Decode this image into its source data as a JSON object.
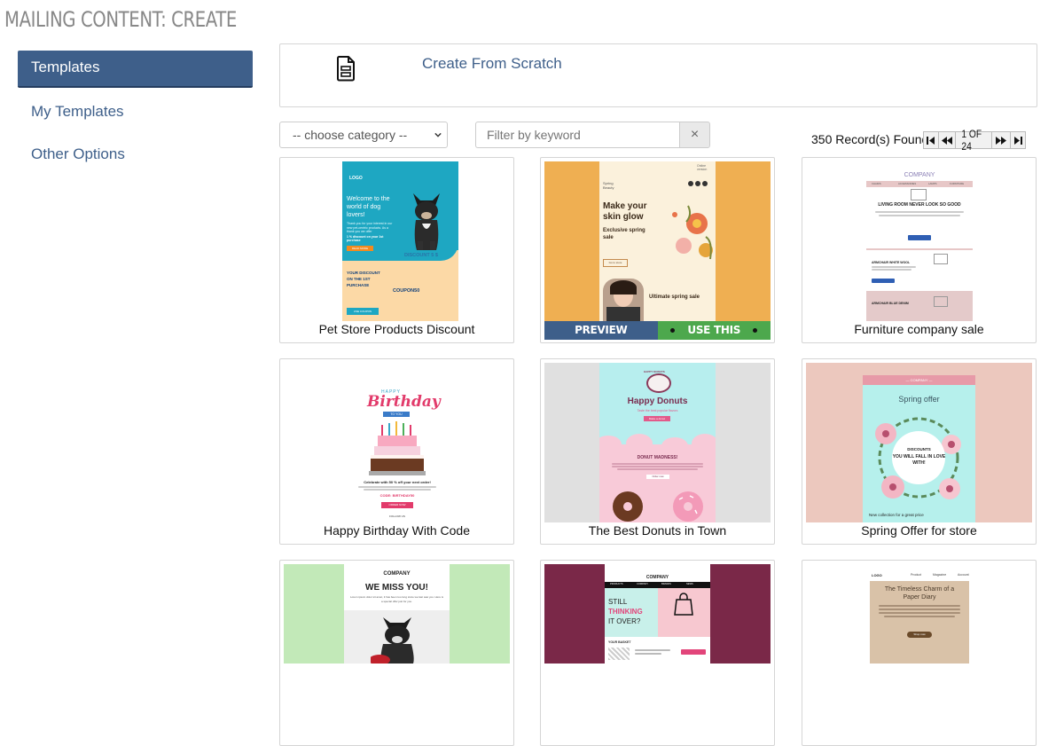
{
  "page": {
    "title": "MAILING CONTENT: CREATE"
  },
  "sidebar": {
    "items": [
      {
        "label": "Templates"
      },
      {
        "label": "My Templates"
      },
      {
        "label": "Other Options"
      }
    ]
  },
  "scratch": {
    "label": "Create From Scratch",
    "icon": "document-icon"
  },
  "filters": {
    "category_value": "-- choose category --",
    "keyword_placeholder": "Filter by keyword",
    "clear_glyph": "×"
  },
  "records": {
    "text": "350 Record(s) Found",
    "page_text": "1 OF 24"
  },
  "actions": {
    "preview": "PREVIEW",
    "use_this": "USE THIS"
  },
  "colors": {
    "accent": "#3e5f8a",
    "use_green": "#4da84d"
  },
  "templates": [
    {
      "name": "Pet Store Products Discount",
      "thumb": {
        "logo": "LOGO",
        "h1": "Welcome to the world of dog lovers!",
        "body": "Thank you for your interest in our new pet-centric products. As a thank you we offer",
        "offer": "1 % discount on your 1st purchase",
        "btn": "READ MORE",
        "discount": "DISCOUNT 5 $",
        "your": "YOUR DISCOUNT ON THE 1ST PURCHASE",
        "code": "COUPON50",
        "btn2": "USE COUPON"
      }
    },
    {
      "name": "Make your skin glow",
      "thumb": {
        "brand": "Spring Beauty",
        "h1": "Make your skin glow",
        "h2": "Exclusive spring sale",
        "btn": "Go to store",
        "h3": "Ultimate spring sale",
        "view": "Online version"
      }
    },
    {
      "name": "Furniture company sale",
      "thumb": {
        "logo": "COMPANY",
        "nav": [
          "CHAIRS",
          "ACCESSORIES",
          "LAMPS",
          "FURNITURE"
        ],
        "h1": "LIVING ROOM NEVER LOOK SO GOOD",
        "h2": "ARMCHAIR WHITE WOOL",
        "h3": "ARMCHAIR BLUE DENIM"
      }
    },
    {
      "name": "Happy Birthday With Code",
      "thumb": {
        "happy": "HAPPY",
        "birthday": "Birthday",
        "ribbon": "TO YOU",
        "line": "Celebrate with 50 % off your next order!",
        "code": "CODE: BIRTHDAY50",
        "btn": "ORDER NOW",
        "foot": "FOLLOW US"
      }
    },
    {
      "name": "The Best Donuts in Town",
      "thumb": {
        "badge": "HAPPY DONUTS",
        "h1": "Happy Donuts",
        "sub": "Taste the best popular flavors",
        "btn": "Make a donut",
        "h2": "DONUT MADNESS!",
        "btn2": "Order now"
      }
    },
    {
      "name": "Spring Offer for store",
      "thumb": {
        "logo": "— COMPANY —",
        "h1": "Spring offer",
        "wreath1": "DISCOUNTS",
        "wreath2": "YOU WILL FALL IN LOVE WITH!",
        "new": "New collection for a great price"
      }
    },
    {
      "name": "",
      "thumb": {
        "logo": "COMPANY",
        "h1": "WE MISS YOU!",
        "body": "Lorem ipsum dolor sit amet, it has been too long since we last saw you. Here is a special offer just for you."
      }
    },
    {
      "name": "",
      "thumb": {
        "logo": "COMPANY",
        "nav": [
          "PRODUCTS",
          "COMPANY",
          "BRANDS",
          "NEWS"
        ],
        "h1a": "STILL",
        "h1b": "THINKING",
        "h1c": "IT OVER?",
        "basket": "YOUR BASKET"
      }
    },
    {
      "name": "",
      "thumb": {
        "logo": "LOGO",
        "nav": [
          "Product",
          "Magazine",
          "Account"
        ],
        "h1": "The Timeless Charm of a Paper Diary",
        "btn": "Shop now"
      }
    }
  ]
}
